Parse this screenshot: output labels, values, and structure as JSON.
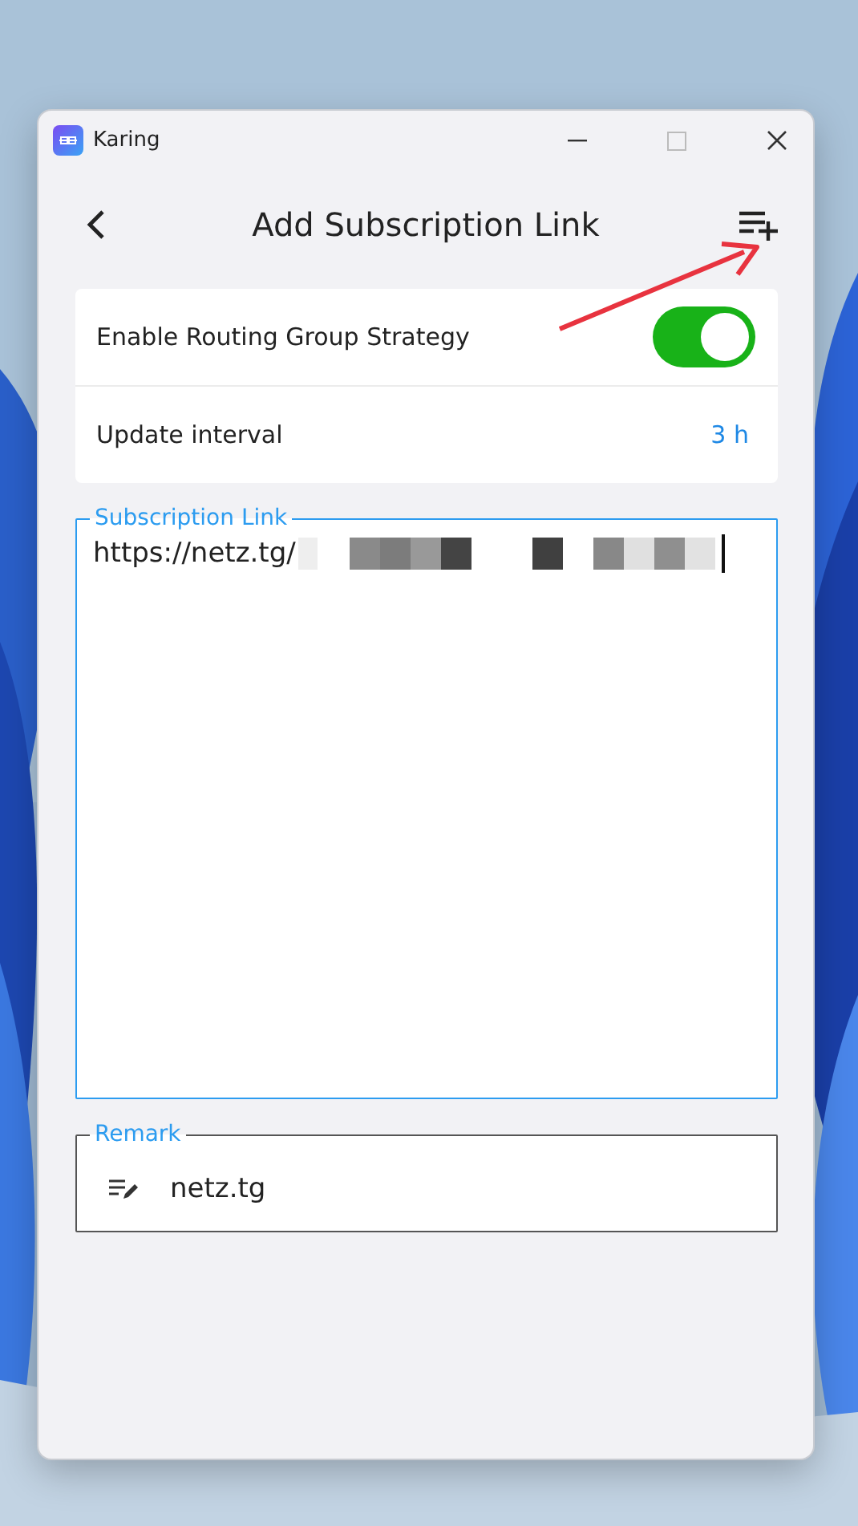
{
  "window": {
    "title": "Karing"
  },
  "header": {
    "title": "Add Subscription Link"
  },
  "settings": [
    {
      "kind": "toggle",
      "label": "Enable Routing Group Strategy",
      "on": true
    },
    {
      "kind": "value",
      "label": "Update interval",
      "value": "3 h"
    }
  ],
  "subscription_link": {
    "label": "Subscription Link",
    "value": "https://netz.tg/",
    "focused": true
  },
  "remark": {
    "label": "Remark",
    "value": "netz.tg",
    "focused": false
  }
}
